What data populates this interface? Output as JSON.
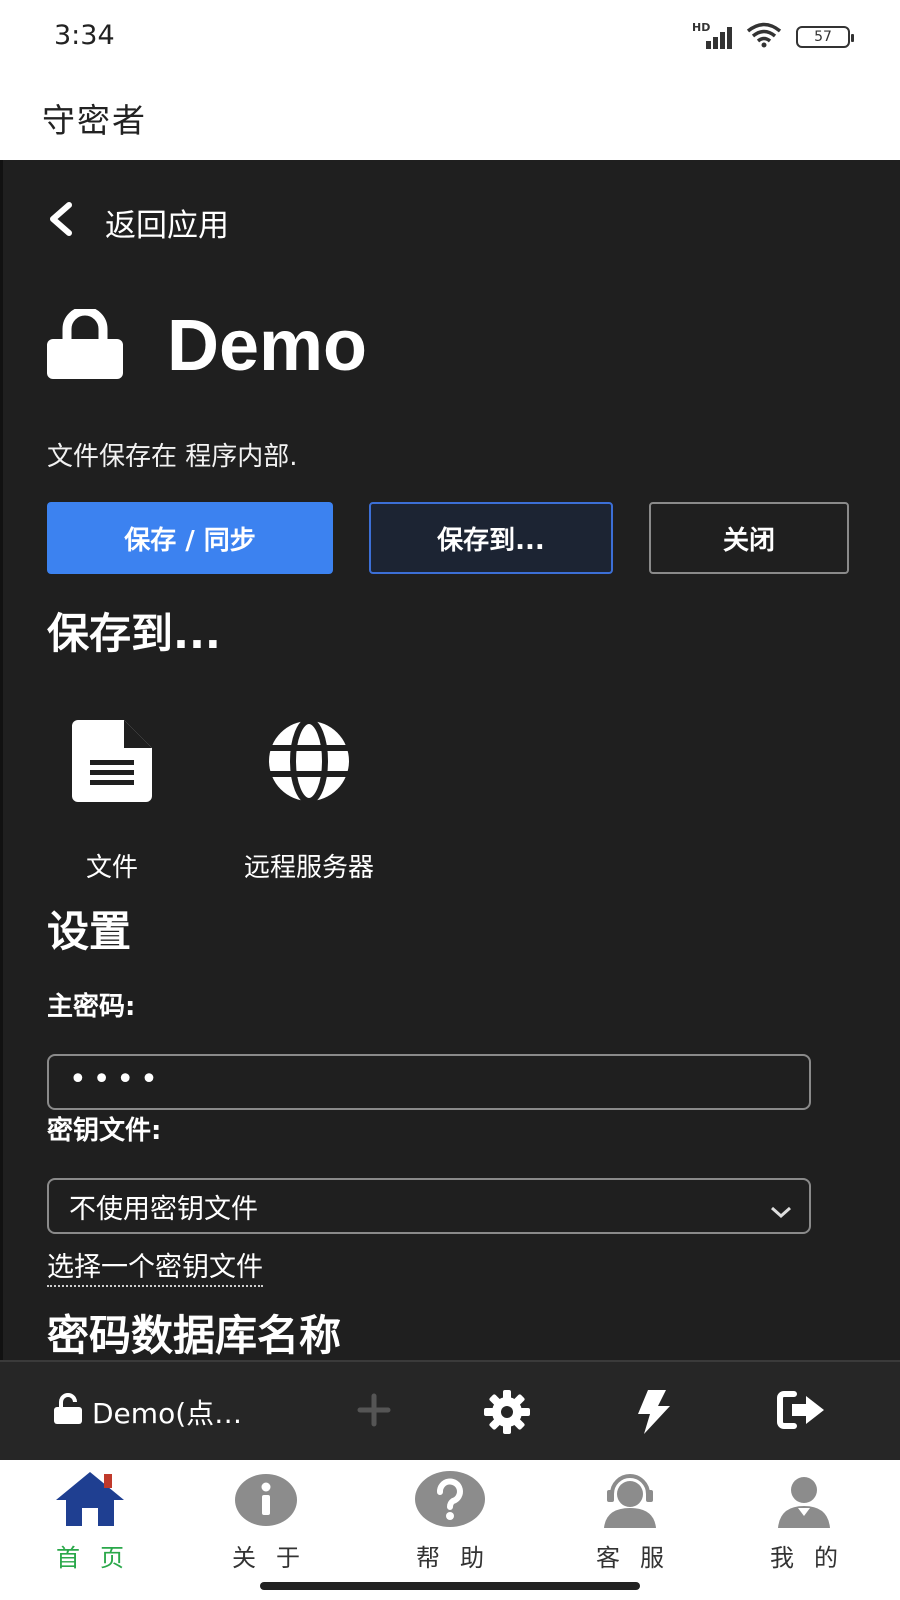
{
  "status_bar": {
    "time": "3:34",
    "battery": "57",
    "network": "HD"
  },
  "app_header": {
    "title": "守密者"
  },
  "back": {
    "label": "返回应用"
  },
  "database": {
    "name": "Demo",
    "saved_location": "文件保存在 程序内部."
  },
  "buttons": {
    "save_sync": "保存 / 同步",
    "save_to": "保存到...",
    "close": "关闭"
  },
  "save_to_section": {
    "title": "保存到...",
    "options": [
      {
        "label": "文件",
        "icon": "file-icon"
      },
      {
        "label": "远程服务器",
        "icon": "globe-icon"
      }
    ]
  },
  "settings": {
    "title": "设置",
    "master_password_label": "主密码:",
    "master_password_value": "••••",
    "key_file_label": "密钥文件:",
    "key_file_selected": "不使用密钥文件",
    "choose_key_file": "选择一个密钥文件",
    "db_name_label": "密码数据库名称"
  },
  "footer": {
    "db_label": "Demo(点…"
  },
  "bottom_nav": {
    "items": [
      {
        "label": "首页",
        "icon": "home-icon",
        "active": true
      },
      {
        "label": "关于",
        "icon": "info-icon"
      },
      {
        "label": "帮助",
        "icon": "help-icon"
      },
      {
        "label": "客服",
        "icon": "support-icon"
      },
      {
        "label": "我的",
        "icon": "user-icon"
      }
    ]
  },
  "colors": {
    "accent": "#3c82f0",
    "dark_bg": "#1f1f1f",
    "nav_active": "#2aa84a",
    "nav_icon": "#8c8c8c",
    "home_icon": "#1f3f91"
  }
}
